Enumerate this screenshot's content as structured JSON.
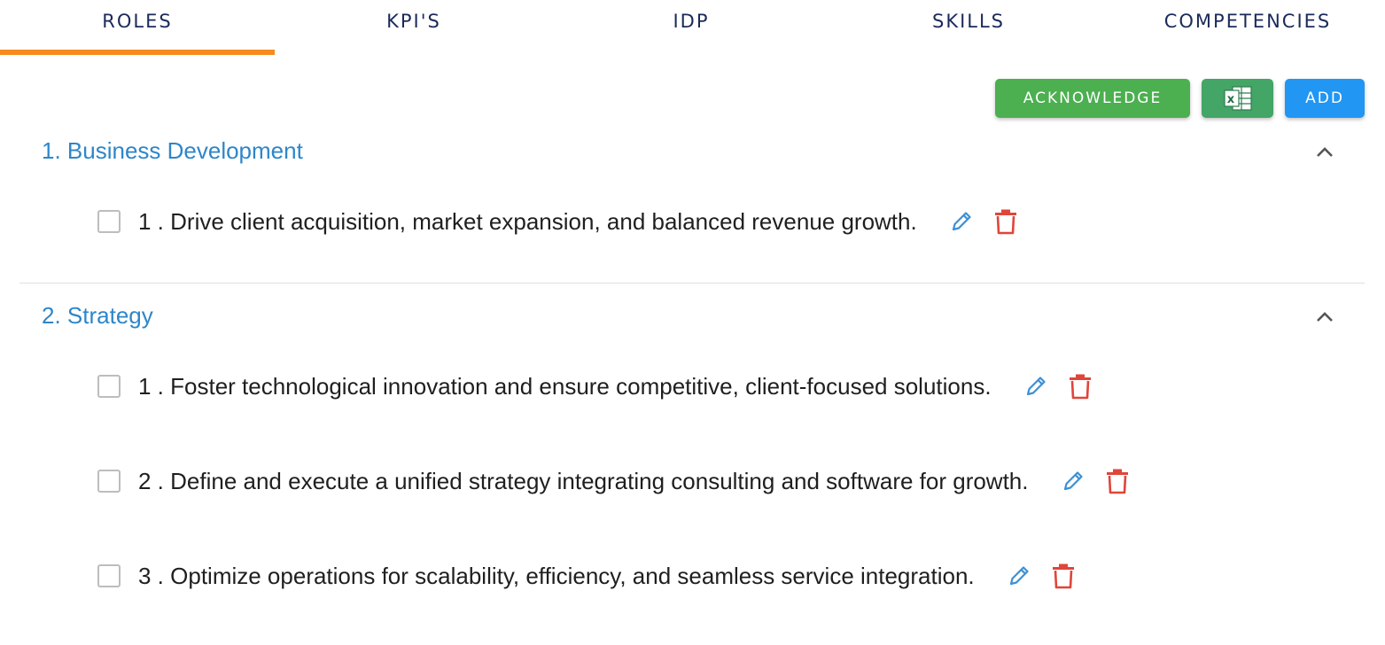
{
  "tabs": [
    {
      "label": "ROLES",
      "active": true
    },
    {
      "label": "KPI'S",
      "active": false
    },
    {
      "label": "IDP",
      "active": false
    },
    {
      "label": "SKILLS",
      "active": false
    },
    {
      "label": "COMPETENCIES",
      "active": false
    }
  ],
  "colors": {
    "accent_tab": "#f68b1f",
    "acknowledge_button": "#4caf50",
    "excel_button": "#43a566",
    "add_button": "#2196f3",
    "section_title": "#2e86c9",
    "edit_icon": "#3d8fd4",
    "delete_icon": "#e0453a"
  },
  "toolbar": {
    "acknowledge_label": "ACKNOWLEDGE",
    "excel_icon": "excel-export-icon",
    "add_label": "ADD"
  },
  "sections": [
    {
      "title": "1. Business Development",
      "expanded": true,
      "items": [
        {
          "text": "1 . Drive client acquisition, market expansion, and balanced revenue growth.",
          "checked": false
        }
      ]
    },
    {
      "title": "2. Strategy",
      "expanded": true,
      "items": [
        {
          "text": "1 . Foster technological innovation and ensure competitive, client-focused solutions.",
          "checked": false
        },
        {
          "text": "2 . Define and execute a unified strategy integrating consulting and software for growth.",
          "checked": false
        },
        {
          "text": "3 . Optimize operations for scalability, efficiency, and seamless service integration.",
          "checked": false
        }
      ]
    }
  ]
}
